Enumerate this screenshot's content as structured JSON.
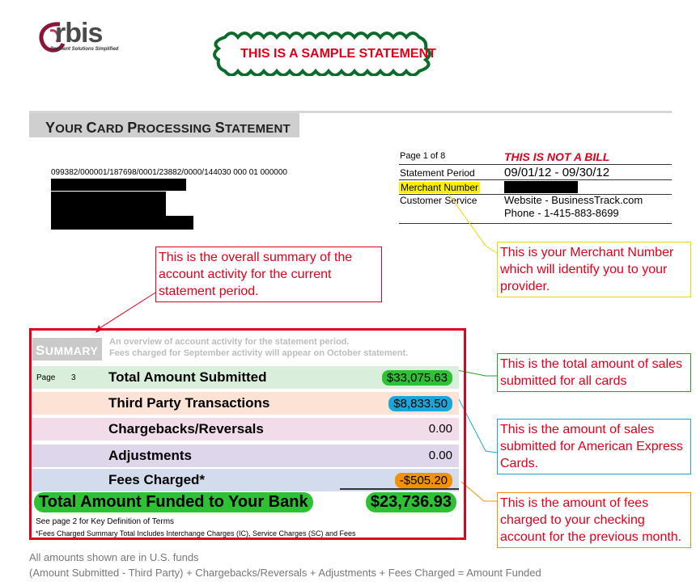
{
  "logo": {
    "word": "rbis",
    "tagline": "Payment Solutions Simplified"
  },
  "banner": {
    "text": "THIS IS A SAMPLE STATEMENT"
  },
  "header": {
    "title_first": "Y",
    "title_rest_1": "OUR ",
    "title_c": "C",
    "title_rest_2": "ARD ",
    "title_p": "P",
    "title_rest_3": "ROCESSING ",
    "title_s": "S",
    "title_rest_4": "TATEMENT"
  },
  "account": {
    "line": "099382/000001/187698/0001/23882/0000/144030 000 01 000000"
  },
  "info": {
    "page_label": "Page 1 of  8",
    "not_bill": "THIS IS NOT A BILL",
    "period_label": "Statement Period",
    "period_value": "09/01/12 - 09/30/12",
    "merchant_label": "Merchant Number",
    "service_label": "Customer Service",
    "website": "Website - BusinessTrack.com",
    "phone": "Phone - 1-415-883-8699"
  },
  "annotations": {
    "overall": "This is the overall summary of the account activity for the current statement period.",
    "merchant": "This is your Merchant Number which will identify you to your provider.",
    "submitted": "This is the total amount of sales submitted for all cards",
    "amex": "This is the amount of sales submitted for American Express Cards.",
    "fees": "This is the amount of fees charged to your checking account for the previous month."
  },
  "summary": {
    "tag_first": "S",
    "tag_rest": "UMMARY",
    "desc_1": "An overview of account activity for the statement period.",
    "desc_2": "Fees charged for September activity will appear on October statement.",
    "page_label": "Page",
    "page_num": "3",
    "rows": [
      {
        "label": "Total Amount Submitted",
        "amount": "$33,075.63",
        "bg": "#d9eedb",
        "pill": "#2ec133"
      },
      {
        "label": "Third Party Transactions",
        "amount": "$8,833.50",
        "bg": "#fde3d6",
        "pill": "#1aa6d8"
      },
      {
        "label": "Chargebacks/Reversals",
        "amount": "0.00",
        "bg": "#f2dcea",
        "pill": ""
      },
      {
        "label": "Adjustments",
        "amount": "0.00",
        "bg": "#ded6ea",
        "pill": ""
      },
      {
        "label": "Fees Charged*",
        "amount": "-$505.20",
        "bg": "#d3dcec",
        "pill": "#f39200"
      }
    ],
    "total_label": "Total Amount Funded to Your Bank",
    "total_amount": "$23,736.93",
    "note_1": "See page 2 for Key Definition of Terms",
    "note_2": "*Fees Charged Summary Total Includes Interchange Charges (IC), Service Charges (SC) and Fees"
  },
  "footer": {
    "line_1": "All amounts shown are in U.S. funds",
    "line_2": "(Amount Submitted - Third Party) + Chargebacks/Reversals + Adjustments + Fees Charged = Amount Funded"
  }
}
